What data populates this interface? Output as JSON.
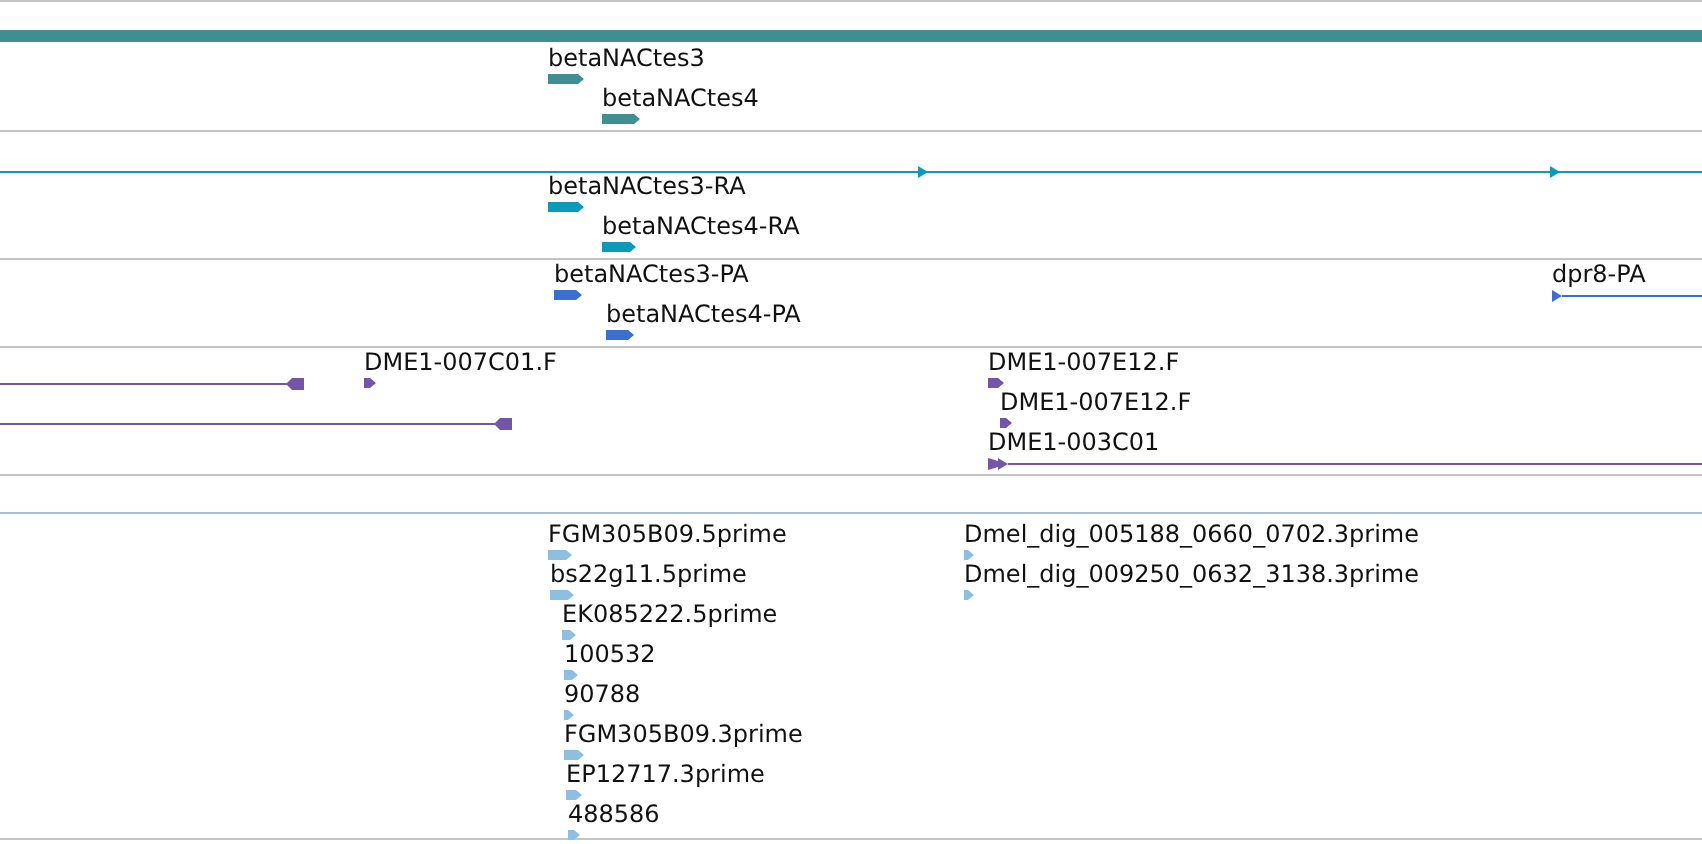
{
  "tracks": [
    {
      "kind": "bar",
      "color": "#3f8e91",
      "features": [
        {
          "kind": "feature",
          "label": "betaNACtes3"
        },
        {
          "kind": "feature",
          "label": "betaNACtes4"
        }
      ]
    },
    {
      "kind": "line",
      "color": "#0f99b8",
      "features": [
        {
          "kind": "feature",
          "label": "betaNACtes3-RA"
        },
        {
          "kind": "feature",
          "label": "betaNACtes4-RA"
        }
      ]
    },
    {
      "kind": "plain",
      "color": "#3a6fcf",
      "features": [
        {
          "kind": "feature",
          "label": "betaNACtes3-PA"
        },
        {
          "kind": "feature",
          "label": "betaNACtes4-PA"
        },
        {
          "kind": "feature-line",
          "label": "dpr8-PA"
        }
      ]
    },
    {
      "kind": "plain",
      "color": "#7356a8",
      "features": [
        {
          "kind": "line"
        },
        {
          "kind": "line"
        },
        {
          "kind": "feature",
          "label": "DME1-007C01.F"
        },
        {
          "kind": "feature",
          "label": "DME1-007E12.F"
        },
        {
          "kind": "feature",
          "label": "DME1-007E12.F"
        },
        {
          "kind": "feature-line",
          "label": "DME1-003C01"
        }
      ]
    },
    {
      "kind": "plain"
    },
    {
      "kind": "plain",
      "color": "#8fbfe0",
      "features": [
        {
          "kind": "feature",
          "label": "FGM305B09.5prime"
        },
        {
          "kind": "feature",
          "label": "bs22g11.5prime"
        },
        {
          "kind": "feature",
          "label": "EK085222.5prime"
        },
        {
          "kind": "feature",
          "label": "100532"
        },
        {
          "kind": "feature",
          "label": "90788"
        },
        {
          "kind": "feature",
          "label": "FGM305B09.3prime"
        },
        {
          "kind": "feature",
          "label": "EP12717.3prime"
        },
        {
          "kind": "feature",
          "label": "488586"
        },
        {
          "kind": "feature",
          "label": "Dmel_dig_005188_0660_0702.3prime"
        },
        {
          "kind": "feature",
          "label": "Dmel_dig_009250_0632_3138.3prime"
        }
      ]
    }
  ]
}
